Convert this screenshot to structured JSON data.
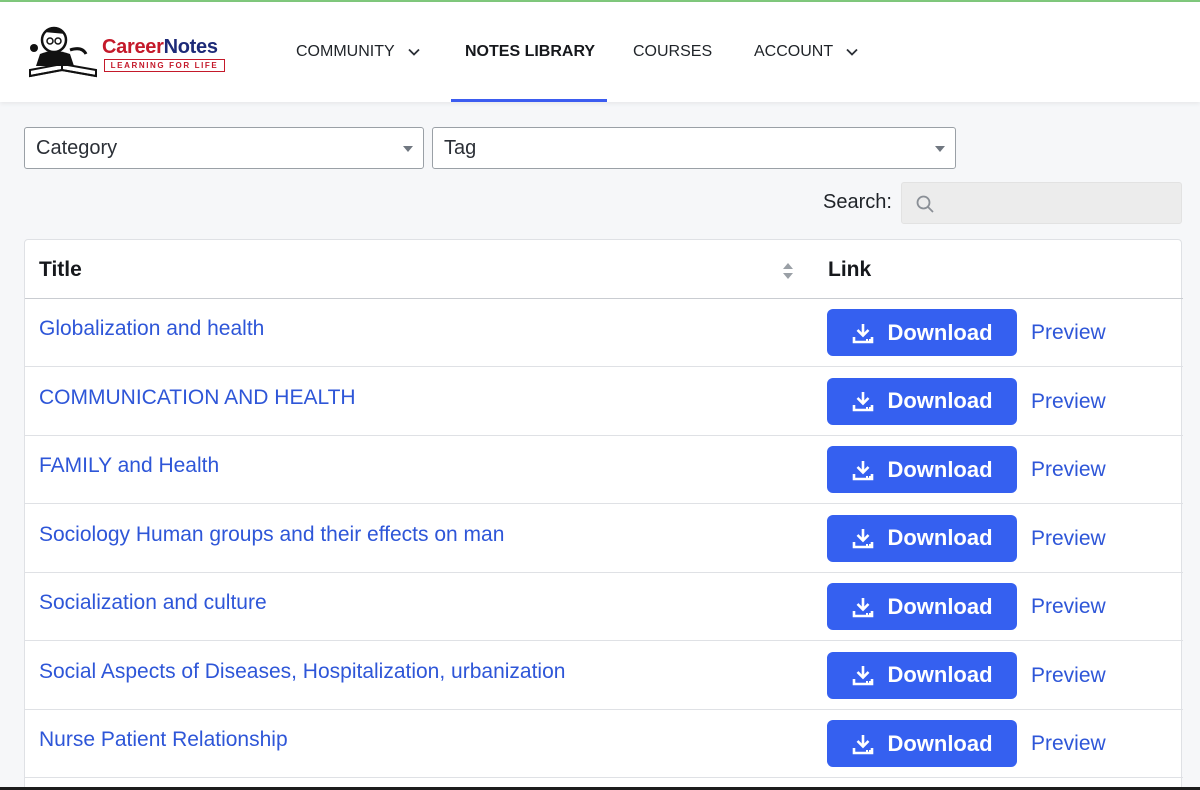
{
  "brand": {
    "name_part1": "Career",
    "name_part2": "Notes",
    "tagline": "LEARNING FOR LIFE"
  },
  "nav": {
    "items": [
      {
        "label": "COMMUNITY",
        "has_dropdown": true
      },
      {
        "label": "NOTES LIBRARY",
        "active": true
      },
      {
        "label": "COURSES"
      },
      {
        "label": "ACCOUNT",
        "has_dropdown": true
      }
    ]
  },
  "filters": {
    "category": "Category",
    "tag": "Tag"
  },
  "search": {
    "label": "Search:",
    "value": ""
  },
  "table": {
    "columns": [
      "Title",
      "Link"
    ],
    "rows": [
      {
        "title": "Globalization and health",
        "download": "Download",
        "preview": "Preview"
      },
      {
        "title": "COMMUNICATION AND HEALTH",
        "download": "Download",
        "preview": "Preview"
      },
      {
        "title": "FAMILY and Health",
        "download": "Download",
        "preview": "Preview"
      },
      {
        "title": "Sociology Human groups and their effects on man",
        "download": "Download",
        "preview": "Preview"
      },
      {
        "title": "Socialization and culture",
        "download": "Download",
        "preview": "Preview"
      },
      {
        "title": "Social Aspects of Diseases, Hospitalization, urbanization",
        "download": "Download",
        "preview": "Preview"
      },
      {
        "title": "Nurse Patient Relationship",
        "download": "Download",
        "preview": "Preview"
      }
    ]
  },
  "colors": {
    "accent": "#3560f0",
    "link": "#2e56d8",
    "brand_red": "#c4192a",
    "brand_blue": "#1d2a78"
  },
  "icons": {
    "logo": "reading-man-logo-icon",
    "chevron": "chevron-down-icon",
    "search": "search-icon",
    "sort": "sort-icon",
    "download": "download-icon"
  }
}
